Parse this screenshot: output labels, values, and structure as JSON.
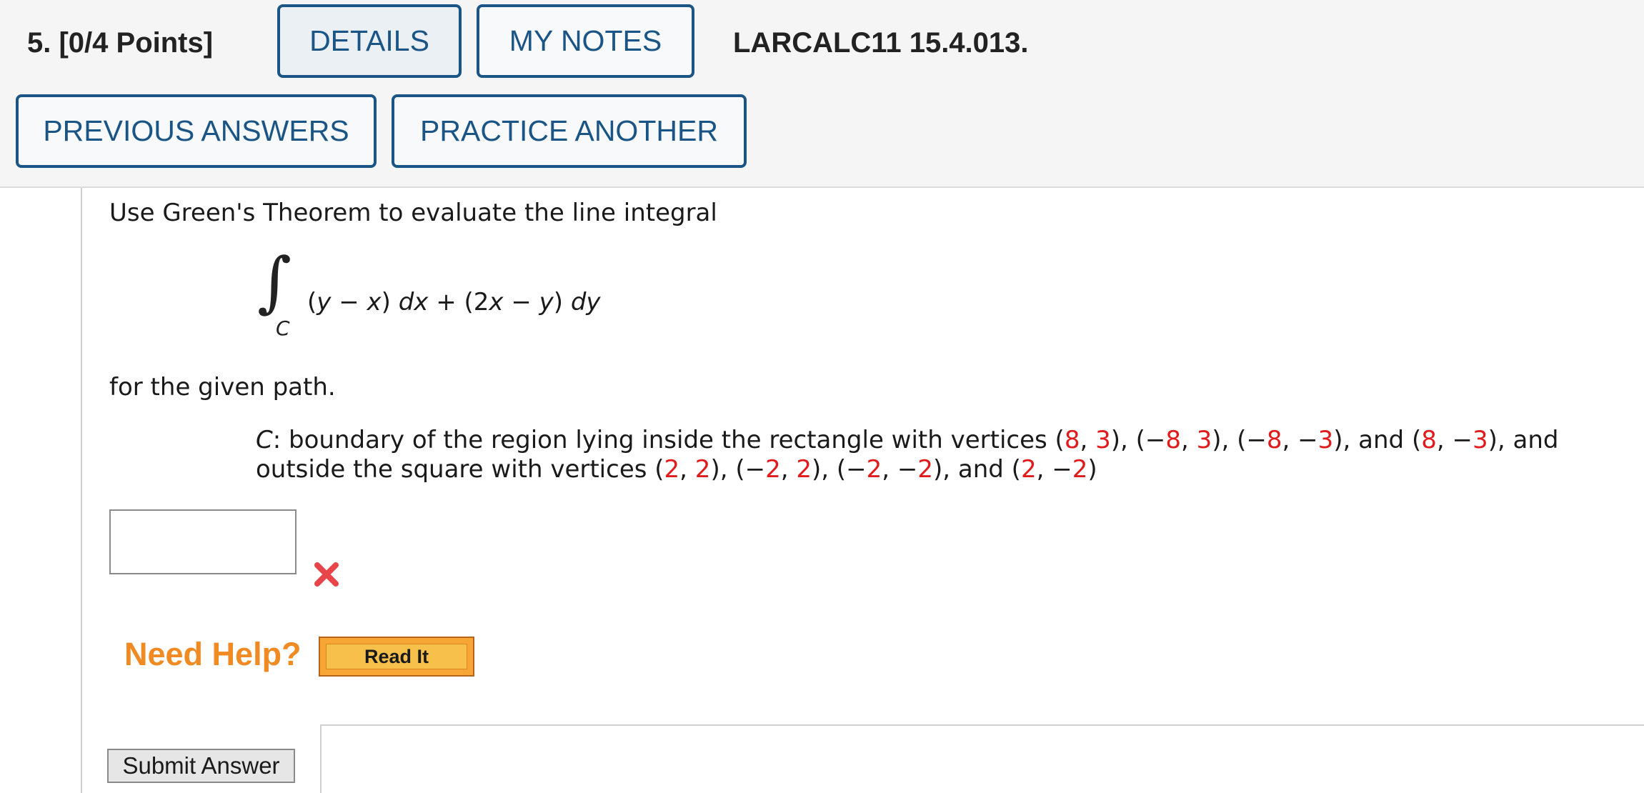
{
  "header": {
    "question_label": "5.  [0/4 Points]",
    "details_button": "DETAILS",
    "notes_button": "MY NOTES",
    "problem_code": "LARCALC11 15.4.013.",
    "previous_answers_button": "PREVIOUS ANSWERS",
    "practice_another_button": "PRACTICE ANOTHER"
  },
  "question": {
    "intro": "Use Green's Theorem to evaluate the line integral",
    "integral": {
      "sign": "∫",
      "subscript": "C",
      "p1": "(",
      "y1": "y",
      "m1": " − ",
      "x1": "x",
      "p2": ") ",
      "dx": "dx",
      "plus": " + (2",
      "x2": "x",
      "m2": " − ",
      "y2": "y",
      "p3": ") ",
      "dy": "dy"
    },
    "for_path": "for the given path.",
    "path": {
      "c_label": "C",
      "line1_prefix": ": boundary of the region lying inside the rectangle with vertices (",
      "v1a": "8",
      "s1": ", ",
      "v1b": "3",
      "c1": "), (−",
      "v2a": "8",
      "s2": ", ",
      "v2b": "3",
      "c2": "), (−",
      "v3a": "8",
      "s3": ", −",
      "v3b": "3",
      "c3": "), and (",
      "v4a": "8",
      "s4": ", −",
      "v4b": "3",
      "c4": "), and",
      "line2_prefix": "outside the square with vertices (",
      "w1a": "2",
      "t1": ", ",
      "w1b": "2",
      "d1": "), (−",
      "w2a": "2",
      "t2": ", ",
      "w2b": "2",
      "d2": "), (−",
      "w3a": "2",
      "t3": ", −",
      "w3b": "2",
      "d3": "), and (",
      "w4a": "2",
      "t4": ", −",
      "w4b": "2",
      "d4": ")"
    },
    "answer_value": ""
  },
  "help": {
    "label": "Need Help?",
    "read_it_button": "Read It"
  },
  "submit_button": "Submit Answer",
  "colors": {
    "accent_blue": "#1b5585",
    "value_red": "#e11b1b",
    "help_orange": "#f08a22",
    "wrong_red": "#e8454b"
  },
  "icons": {
    "status": "wrong-x-icon"
  }
}
